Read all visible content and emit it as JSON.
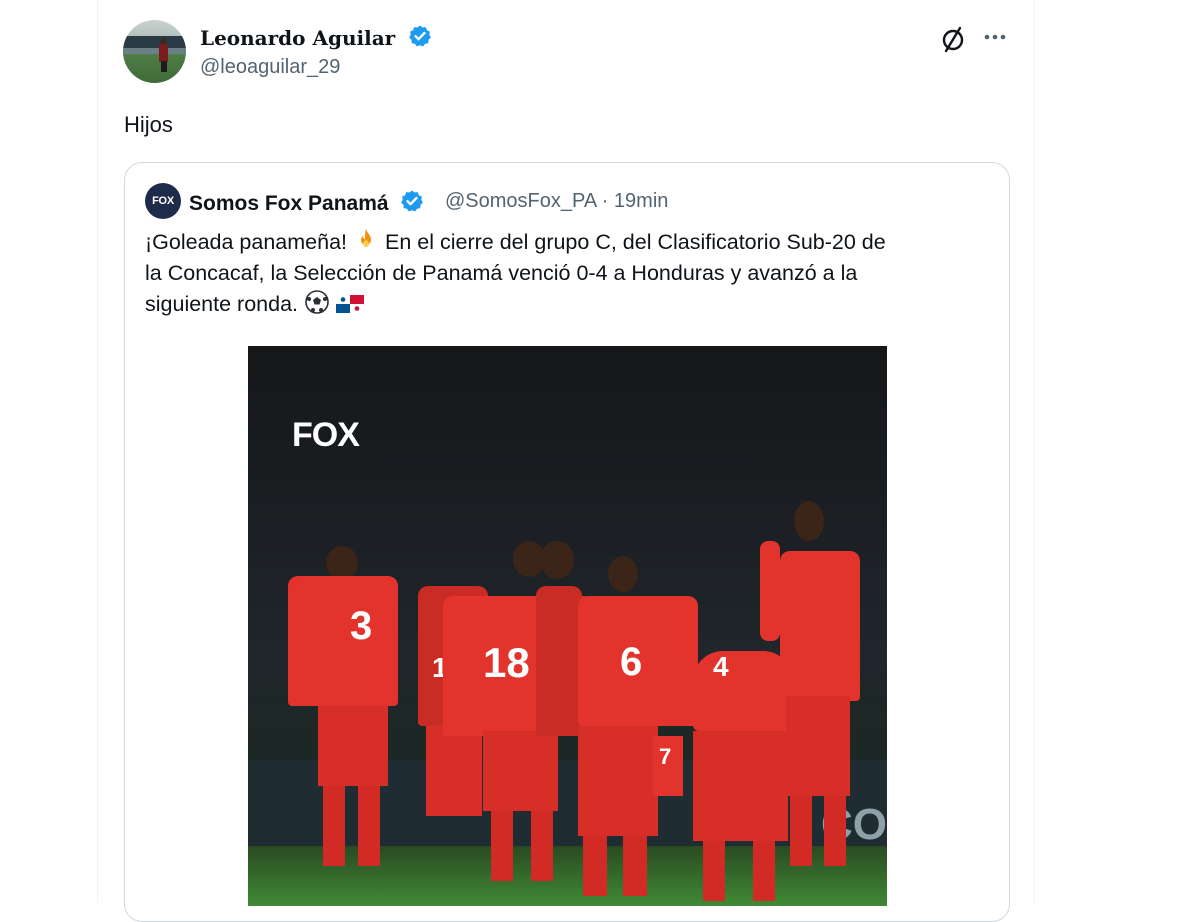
{
  "tweet": {
    "author_name": "Leonardo Aguilar",
    "author_handle": "@leoaguilar_29",
    "text": "Hijos"
  },
  "quote": {
    "avatar_text": "FOX",
    "name": "Somos Fox Panamá",
    "handle": "@SomosFox_PA",
    "separator": "·",
    "time": "19min",
    "lines": [
      "¡Goleada panameña!",
      "En el cierre del grupo C, del Clasificatorio Sub-20 de",
      "la Concacaf, la Selección de Panamá venció 0-4 a Honduras y avanzó a la",
      "siguiente ronda."
    ]
  },
  "media": {
    "logo": "FOX",
    "jersey_numbers": [
      "3",
      "18",
      "6",
      "4",
      "7",
      "18"
    ]
  },
  "icons": {
    "verified": "verified-badge-icon",
    "grok": "grok-icon",
    "more": "more-icon",
    "fire": "fire-emoji",
    "soccer": "soccer-ball-emoji",
    "flag": "panama-flag-emoji"
  },
  "colors": {
    "verified": "#1d9bf0",
    "secondary_text": "#536471",
    "border": "#cfd9de",
    "jersey": "#e2342c"
  }
}
